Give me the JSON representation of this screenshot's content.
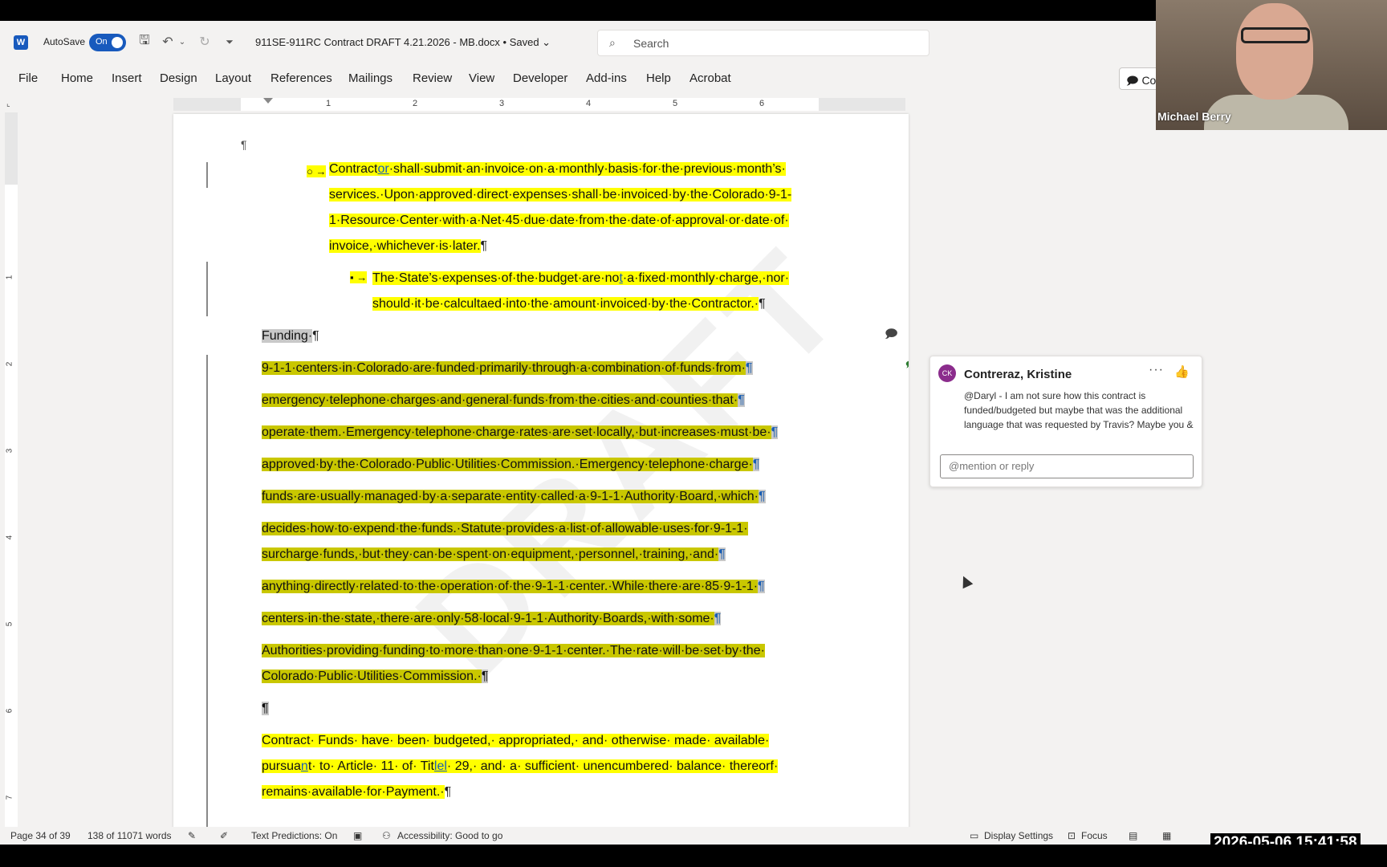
{
  "titlebar": {
    "autosave_label": "AutoSave",
    "autosave_state": "On",
    "document_title": "911SE-911RC Contract DRAFT 4.21.2026 - MB.docx • Saved ⌄",
    "search_placeholder": "Search"
  },
  "ribbon": {
    "tabs": [
      "File",
      "Home",
      "Insert",
      "Design",
      "Layout",
      "References",
      "Mailings",
      "Review",
      "View",
      "Developer",
      "Add-ins",
      "Help",
      "Acrobat"
    ],
    "comments_label": "Com"
  },
  "ruler": {
    "numbers": [
      "1",
      "2",
      "3",
      "4",
      "5",
      "6"
    ]
  },
  "vruler": {
    "numbers": [
      "1",
      "2",
      "3",
      "4",
      "5",
      "6",
      "7"
    ]
  },
  "document": {
    "empty_para": "¶",
    "bullet1_marker": "○ →",
    "bullet1_l1_a": "Contract",
    "bullet1_l1_b": "or",
    "bullet1_l1_c": "·shall·submit·an·invoice·on·a·monthly·basis·for·the·previous·month’s·",
    "bullet1_l2": "services.·Upon·approved·direct·expenses·shall·be·invoiced·by·the·Colorado·9-1-",
    "bullet1_l3": "1·Resource·Center·with·a·Net·45·due·date·from·the·date·of·approval·or·date·of·",
    "bullet1_l4": "invoice,·whichever·is·later.",
    "bullet2_marker": "▪ →",
    "bullet2_l1_a": "The·State’s·expenses·of·the·budget·are·no",
    "bullet2_l1_b": "t",
    "bullet2_l1_c": "·a·fixed·monthly·charge,·nor·",
    "bullet2_l2": "should·it·be·calcultaed·into·the·amount·invoiced·by·the·Contractor.·",
    "heading": "Funding·",
    "funding_lines": [
      "9-1-1·centers·in·Colorado·are·funded·primarily·through·a·combination·of·funds·from·",
      "emergency·telephone·charges·and·general·funds·from·the·cities·and·counties·that·",
      "operate·them.·Emergency·telephone·charge·rates·are·set·locally,·but·increases·must·be·",
      "approved·by·the·Colorado·Public·Utilities·Commission.·Emergency·telephone·charge·",
      "funds·are·usually·managed·by·a·separate·entity·called·a·9-1-1·Authority·Board,·which·",
      "decides·how·to·expend·the·funds.·Statute·provides·a·list·of·allowable·uses·for·9-1-1·",
      "surcharge·funds,·but·they·can·be·spent·on·equipment,·personnel,·training,·and·",
      "anything·directly·related·to·the·operation·of·the·9-1-1·center.·While·there·are·85·9-1-1·",
      "centers·in·the·state,·there·are·only·58·local·9-1-1·Authority·Boards,·with·some·",
      "Authorities·providing·funding·to·more·than·one·9-1-1·center.·The·rate·will·be·set·by·the·",
      "Colorado·Public·Utilities·Commission.·"
    ],
    "contract_l1": "Contract·  Funds·  have·  been·  budgeted,·  appropriated,·  and·  otherwise·  made·  available·",
    "contract_l2_a": "pursua",
    "contract_l2_b": "n",
    "contract_l2_c": "t·  to·  Article·  11·  of·  Tit",
    "contract_l2_d": "lel",
    "contract_l2_e": "·  29,·  and·  a·  sufficient·  unencumbered·  balance·  thereorf·",
    "contract_l3": "remains·available·for·Payment.·",
    "watermark": "DRAFT"
  },
  "comment": {
    "initials": "CK",
    "author": "Contreraz, Kristine",
    "more": "···",
    "body": "@Daryl - I am not sure how this contract is funded/budgeted but maybe that was the additional language that was requested by Travis? Maybe you & I can troubleshoot and add",
    "reply_placeholder": "@mention or reply"
  },
  "statusbar": {
    "page": "Page 34 of 39",
    "words": "138 of 11071 words",
    "text_predictions": "Text Predictions: On",
    "accessibility": "Accessibility: Good to go",
    "display_settings": "Display Settings",
    "focus": "Focus"
  },
  "video": {
    "name": "Michael Berry"
  },
  "timestamp": "2026-05-06  15:41:58",
  "colors": {
    "accent": "#185abd",
    "highlight": "#ffff00",
    "selection": "#c8c8c8"
  }
}
